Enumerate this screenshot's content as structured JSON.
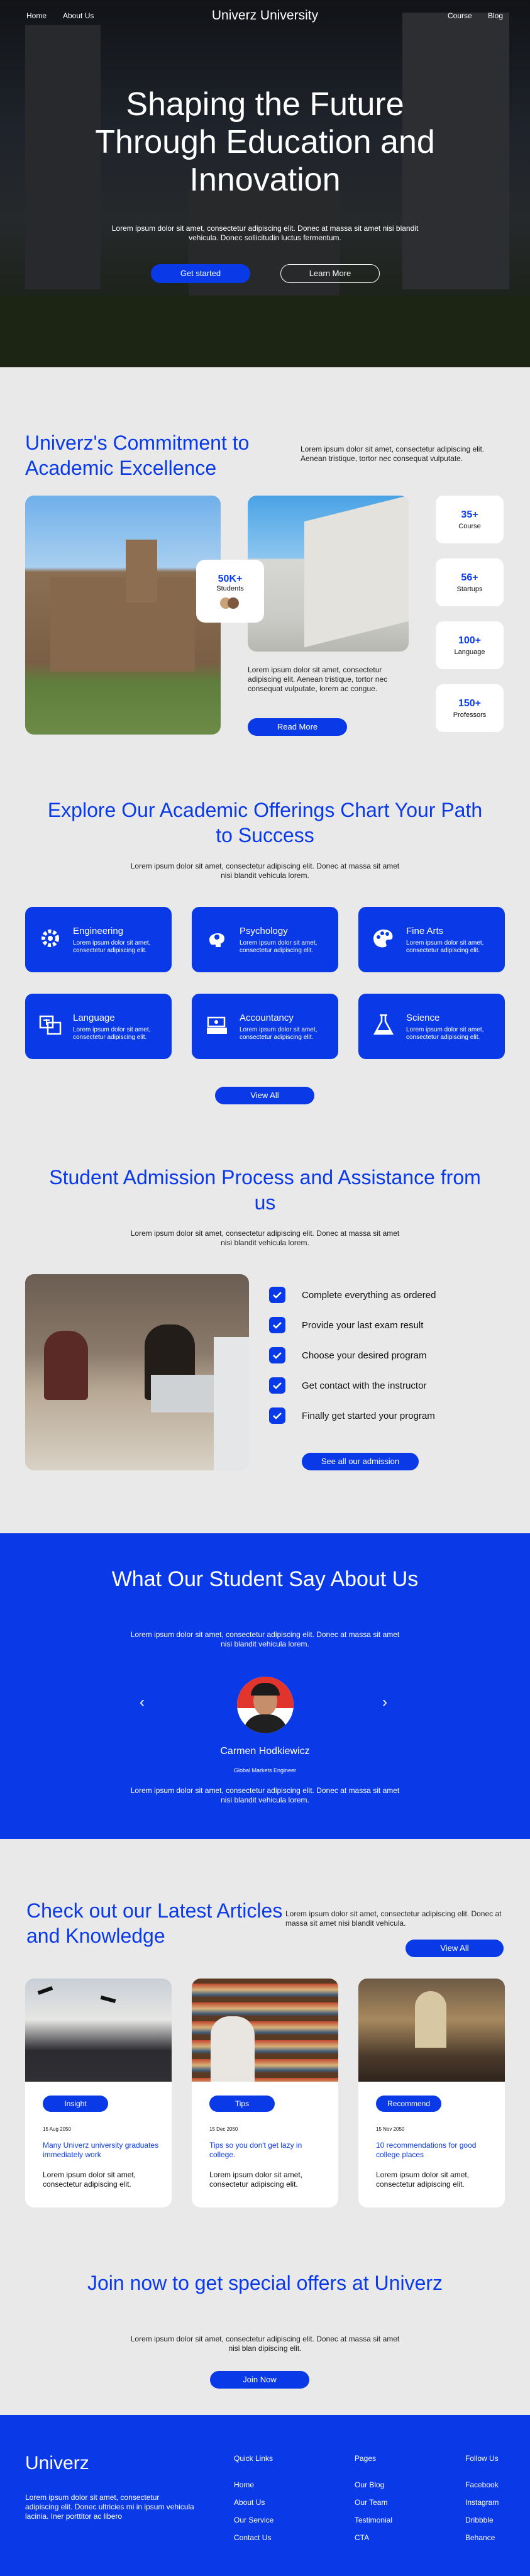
{
  "nav": {
    "home": "Home",
    "about": "About Us",
    "brand": "Univerz University",
    "course": "Course",
    "blog": "Blog"
  },
  "hero": {
    "title": "Shaping the Future Through Education and Innovation",
    "subtitle": "Lorem ipsum dolor sit amet, consectetur adipiscing elit. Donec at massa sit amet nisi blandit vehicula. Donec sollicitudin luctus fermentum.",
    "cta_primary": "Get started",
    "cta_secondary": "Learn More"
  },
  "commitment": {
    "title": "Univerz's Commitment to Academic Excellence",
    "text": "Lorem ipsum dolor sit amet, consectetur adipiscing elit. Aenean tristique, tortor nec consequat vulputate.",
    "students_count": "50K+",
    "students_label": "Students",
    "body": "Lorem ipsum dolor sit amet, consectetur adipiscing elit. Aenean tristique, tortor nec consequat vulputate, lorem ac congue.",
    "read_more": "Read More",
    "stats": [
      {
        "num": "35+",
        "label": "Course"
      },
      {
        "num": "56+",
        "label": "Startups"
      },
      {
        "num": "100+",
        "label": "Language"
      },
      {
        "num": "150+",
        "label": "Professors"
      }
    ]
  },
  "offerings": {
    "title": "Explore Our Academic Offerings Chart Your Path to Success",
    "subtitle": "Lorem ipsum dolor sit amet, consectetur adipiscing elit. Donec at massa sit amet nisi blandit vehicula lorem.",
    "cards": [
      {
        "title": "Engineering",
        "desc": "Lorem ipsum dolor sit amet, consectetur adipiscing elit.",
        "icon": "gear-icon"
      },
      {
        "title": "Psychology",
        "desc": "Lorem ipsum dolor sit amet, consectetur adipiscing elit.",
        "icon": "brain-icon"
      },
      {
        "title": "Fine Arts",
        "desc": "Lorem ipsum dolor sit amet, consectetur adipiscing elit.",
        "icon": "palette-icon"
      },
      {
        "title": "Language",
        "desc": "Lorem ipsum dolor sit amet, consectetur adipiscing elit.",
        "icon": "translate-icon"
      },
      {
        "title": "Accountancy",
        "desc": "Lorem ipsum dolor sit amet, consectetur adipiscing elit.",
        "icon": "cash-icon"
      },
      {
        "title": "Science",
        "desc": "Lorem ipsum dolor sit amet, consectetur adipiscing elit.",
        "icon": "flask-icon"
      }
    ],
    "view_all": "View All"
  },
  "admission": {
    "title": "Student Admission Process and Assistance from us",
    "subtitle": "Lorem ipsum dolor sit amet, consectetur adipiscing elit. Donec at massa sit amet nisi blandit vehicula lorem.",
    "steps": [
      "Complete everything as ordered",
      "Provide your last exam result",
      "Choose your desired program",
      "Get contact with the instructor",
      "Finally get started your program"
    ],
    "cta": "See all our admission"
  },
  "testimonial": {
    "title": "What Our Student Say About Us",
    "subtitle": "Lorem ipsum dolor sit amet, consectetur adipiscing elit. Donec at massa sit amet nisi blandit vehicula lorem.",
    "name": "Carmen Hodkiewicz",
    "role": "Global Markets Engineer",
    "quote": "Lorem ipsum dolor sit amet, consectetur adipiscing elit. Donec at massa sit amet nisi blandit vehicula lorem."
  },
  "articles": {
    "title": "Check out our Latest Articles and Knowledge",
    "text": "Lorem ipsum dolor sit amet, consectetur adipiscing elit. Donec at massa sit amet nisi blandit vehicula.",
    "view_all": "View All",
    "items": [
      {
        "tag": "Insight",
        "date": "15 Aug 2050",
        "title": "Many Univerz university graduates immediately work",
        "desc": "Lorem ipsum dolor sit amet, consectetur adipiscing elit."
      },
      {
        "tag": "Tips",
        "date": "15 Dec 2050",
        "title": "Tips so you don't get lazy in college.",
        "desc": "Lorem ipsum dolor sit amet, consectetur adipiscing elit."
      },
      {
        "tag": "Recommend",
        "date": "15 Nov 2050",
        "title": "10 recommendations for good college places",
        "desc": "Lorem ipsum dolor sit amet, consectetur adipiscing elit."
      }
    ]
  },
  "join": {
    "title": "Join now to get special offers at Univerz",
    "subtitle": "Lorem ipsum dolor sit amet, consectetur adipiscing elit. Donec at massa sit amet nisi blan dipiscing elit.",
    "cta": "Join Now"
  },
  "footer": {
    "brand": "Univerz",
    "desc": "Lorem ipsum dolor sit amet, consectetur adipiscing elit. Donec ultricies mi in ipsum vehicula lacinia. Iner porttitor ac libero",
    "quick_links": {
      "heading": "Quick Links",
      "items": [
        "Home",
        "About Us",
        "Our Service",
        "Contact Us"
      ]
    },
    "pages": {
      "heading": "Pages",
      "items": [
        "Our Blog",
        "Our Team",
        "Testimonial",
        "CTA"
      ]
    },
    "follow": {
      "heading": "Follow Us",
      "items": [
        "Facebook",
        "Instagram",
        "Dribbble",
        "Behance"
      ]
    }
  },
  "colors": {
    "accent": "#0a3ae8",
    "background": "#e9e9e9"
  }
}
